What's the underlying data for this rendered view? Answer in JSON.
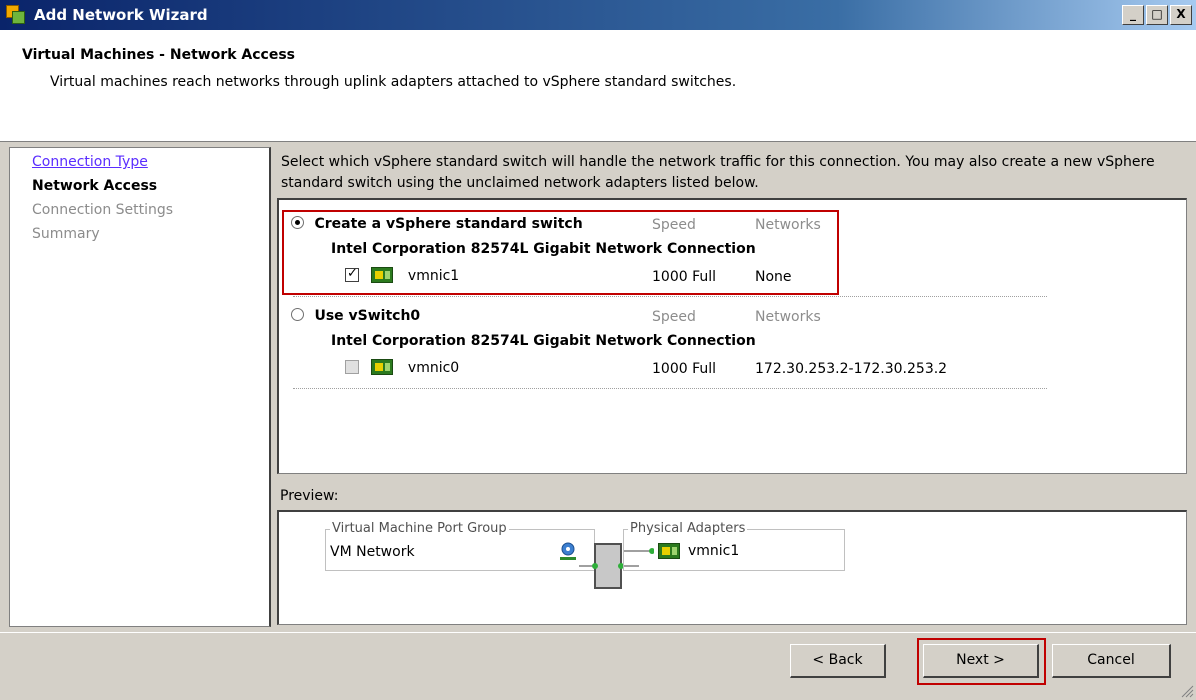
{
  "window": {
    "title": "Add Network Wizard",
    "minimize_glyph": "_",
    "maximize_glyph": "□",
    "close_glyph": "X"
  },
  "header": {
    "title": "Virtual Machines - Network Access",
    "description": "Virtual machines reach networks through uplink adapters attached to vSphere standard switches."
  },
  "nav": {
    "items": [
      {
        "label": "Connection Type",
        "state": "link"
      },
      {
        "label": "Network Access",
        "state": "current"
      },
      {
        "label": "Connection Settings",
        "state": "pending"
      },
      {
        "label": "Summary",
        "state": "pending"
      }
    ]
  },
  "main": {
    "instruction": "Select which vSphere standard switch will handle the network traffic for this connection. You may also create a new vSphere standard switch using the unclaimed network adapters listed below.",
    "options": [
      {
        "label": "Create a vSphere standard switch",
        "selected": true,
        "speed_header": "Speed",
        "networks_header": "Networks",
        "adapter_group": "Intel Corporation 82574L Gigabit Network Connection",
        "adapter": {
          "name": "vmnic1",
          "checked": true,
          "speed": "1000 Full",
          "networks": "None"
        }
      },
      {
        "label": "Use vSwitch0",
        "selected": false,
        "speed_header": "Speed",
        "networks_header": "Networks",
        "adapter_group": "Intel Corporation 82574L Gigabit Network Connection",
        "adapter": {
          "name": "vmnic0",
          "checked": false,
          "speed": "1000 Full",
          "networks": "172.30.253.2-172.30.253.2"
        }
      }
    ]
  },
  "preview": {
    "label": "Preview:",
    "port_group_legend": "Virtual Machine Port Group",
    "port_group_name": "VM Network",
    "physical_adapters_legend": "Physical Adapters",
    "physical_adapter_name": "vmnic1"
  },
  "footer": {
    "back_label": "< Back",
    "next_label": "Next >",
    "cancel_label": "Cancel"
  },
  "colors": {
    "highlight": "#c00000",
    "link": "#5a2dff",
    "title_bar": "#0a246a"
  }
}
